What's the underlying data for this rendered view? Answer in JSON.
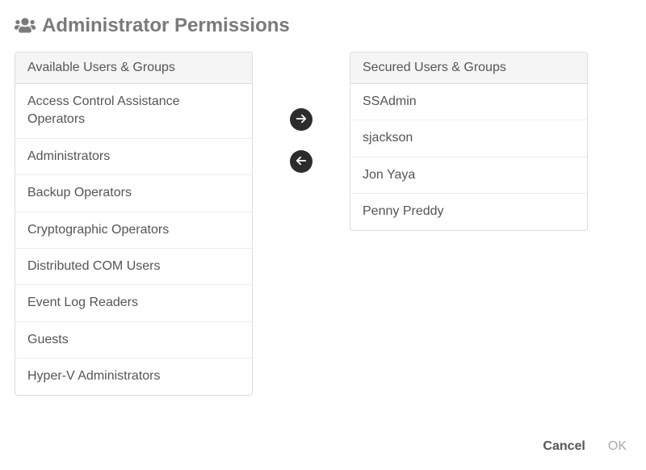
{
  "header": {
    "title": "Administrator Permissions",
    "icon": "users-icon"
  },
  "available_panel": {
    "heading": "Available Users & Groups",
    "items": [
      "Access Control Assistance Operators",
      "Administrators",
      "Backup Operators",
      "Cryptographic Operators",
      "Distributed COM Users",
      "Event Log Readers",
      "Guests",
      "Hyper-V Administrators"
    ]
  },
  "secured_panel": {
    "heading": "Secured Users & Groups",
    "items": [
      "SSAdmin",
      "sjackson",
      "Jon Yaya",
      "Penny Preddy"
    ]
  },
  "arrows": {
    "right": "arrow-right-icon",
    "left": "arrow-left-icon"
  },
  "footer": {
    "cancel": "Cancel",
    "ok": "OK"
  }
}
